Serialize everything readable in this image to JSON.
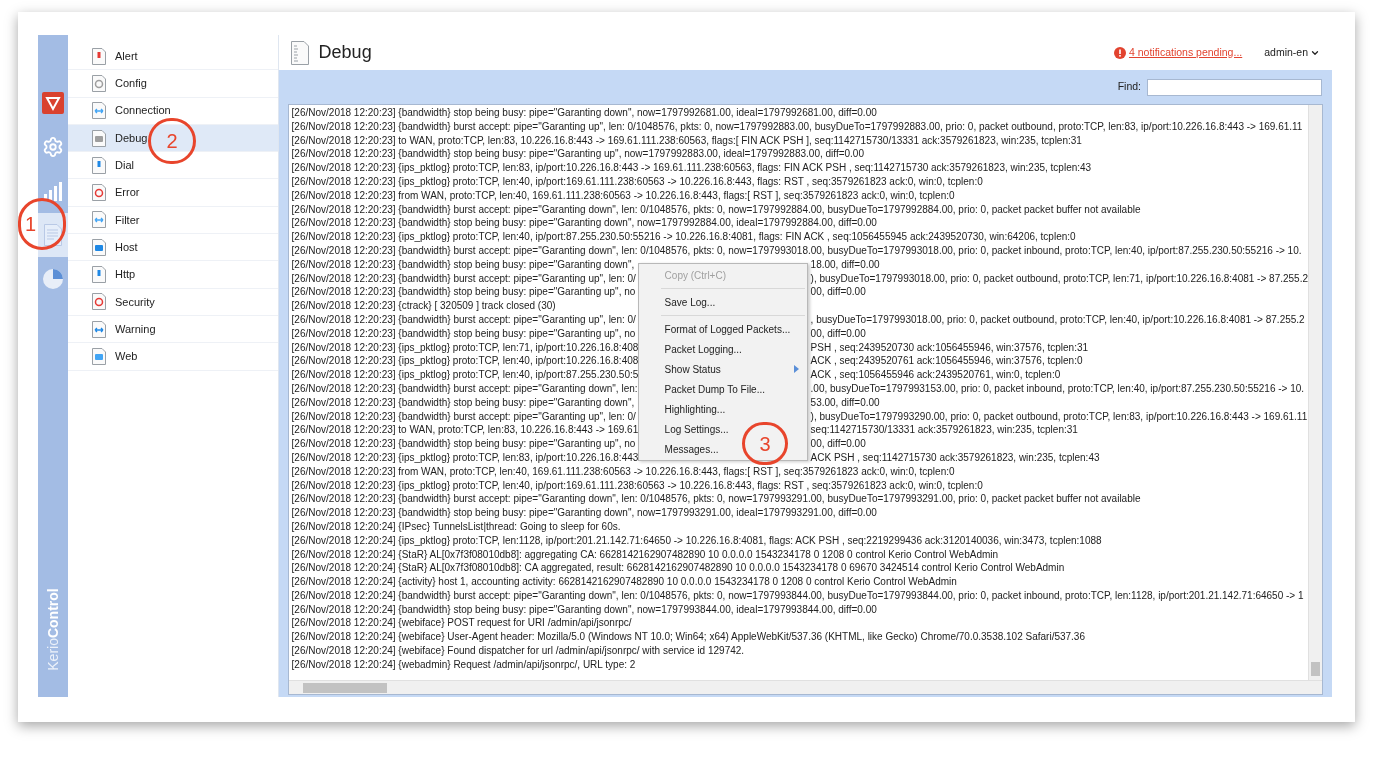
{
  "rail": {
    "brand_light": "Kerio",
    "brand_bold": "Control",
    "items": [
      {
        "selected": false
      },
      {
        "selected": false
      },
      {
        "selected": false
      },
      {
        "selected": true
      },
      {
        "selected": false
      }
    ]
  },
  "log_types": [
    {
      "label": "Alert",
      "selected": false
    },
    {
      "label": "Config",
      "selected": false
    },
    {
      "label": "Connection",
      "selected": false
    },
    {
      "label": "Debug",
      "selected": true
    },
    {
      "label": "Dial",
      "selected": false
    },
    {
      "label": "Error",
      "selected": false
    },
    {
      "label": "Filter",
      "selected": false
    },
    {
      "label": "Host",
      "selected": false
    },
    {
      "label": "Http",
      "selected": false
    },
    {
      "label": "Security",
      "selected": false
    },
    {
      "label": "Warning",
      "selected": false
    },
    {
      "label": "Web",
      "selected": false
    }
  ],
  "header": {
    "title": "Debug",
    "notifications": "4 notifications pending...",
    "user": "admin-en"
  },
  "toolbar": {
    "find_label": "Find:"
  },
  "log_lines": [
    {
      "text": "[26/Nov/2018 12:20:23] {bandwidth} stop being busy: pipe=\"Garanting down\", now=1797992681.00, ideal=1797992681.00, diff=0.00"
    },
    {
      "text": "[26/Nov/2018 12:20:23] {bandwidth} burst accept: pipe=\"Garanting up\", len: 0/1048576, pkts: 0, now=1797992883.00, busyDueTo=1797992883.00, prio: 0, packet outbound, proto:TCP, len:83, ip/port:10.226.16.8:443 -> 169.61.11"
    },
    {
      "text": "[26/Nov/2018 12:20:23] to WAN, proto:TCP, len:83, 10.226.16.8:443 -> 169.61.111.238:60563, flags:[ FIN ACK PSH ], seq:1142715730/13331 ack:3579261823, win:235, tcplen:31"
    },
    {
      "text": "[26/Nov/2018 12:20:23] {bandwidth} stop being busy: pipe=\"Garanting up\", now=1797992883.00, ideal=1797992883.00, diff=0.00"
    },
    {
      "text": "[26/Nov/2018 12:20:23] {ips_pktlog} proto:TCP, len:83, ip/port:10.226.16.8:443 -> 169.61.111.238:60563, flags: FIN ACK PSH , seq:1142715730 ack:3579261823, win:235, tcplen:43"
    },
    {
      "text": "[26/Nov/2018 12:20:23] {ips_pktlog} proto:TCP, len:40, ip/port:169.61.111.238:60563 -> 10.226.16.8:443, flags: RST , seq:3579261823 ack:0, win:0, tcplen:0"
    },
    {
      "text": "[26/Nov/2018 12:20:23] from WAN, proto:TCP, len:40, 169.61.111.238:60563 -> 10.226.16.8:443, flags:[ RST ], seq:3579261823 ack:0, win:0, tcplen:0"
    },
    {
      "text": "[26/Nov/2018 12:20:23] {bandwidth} burst accept: pipe=\"Garanting down\", len: 0/1048576, pkts: 0, now=1797992884.00, busyDueTo=1797992884.00, prio: 0, packet packet buffer not available"
    },
    {
      "text": "[26/Nov/2018 12:20:23] {bandwidth} stop being busy: pipe=\"Garanting down\", now=1797992884.00, ideal=1797992884.00, diff=0.00"
    },
    {
      "text": "[26/Nov/2018 12:20:23] {ips_pktlog} proto:TCP, len:40, ip/port:87.255.230.50:55216 -> 10.226.16.8:4081, flags: FIN ACK , seq:1056455945 ack:2439520730, win:64206, tcplen:0"
    },
    {
      "text": "[26/Nov/2018 12:20:23] {bandwidth} burst accept: pipe=\"Garanting down\", len: 0/1048576, pkts: 0, now=1797993018.00, busyDueTo=1797993018.00, prio: 0, packet inbound, proto:TCP, len:40, ip/port:87.255.230.50:55216 -> 10."
    },
    {
      "left": "[26/Nov/2018 12:20:23] {bandwidth} stop being busy: pipe=\"Garanting down\",",
      "right": "18.00, diff=0.00"
    },
    {
      "left": "[26/Nov/2018 12:20:23] {bandwidth} burst accept: pipe=\"Garanting up\", len: 0/",
      "right": "), busyDueTo=1797993018.00, prio: 0, packet outbound, proto:TCP, len:71, ip/port:10.226.16.8:4081 -> 87.255.2"
    },
    {
      "left": "[26/Nov/2018 12:20:23] {bandwidth} stop being busy: pipe=\"Garanting up\", no",
      "right": "00, diff=0.00"
    },
    {
      "text": "[26/Nov/2018 12:20:23] {ctrack} [ 320509 ] track closed (30)"
    },
    {
      "left": "[26/Nov/2018 12:20:23] {bandwidth} burst accept: pipe=\"Garanting up\", len: 0/",
      "right": ", busyDueTo=1797993018.00, prio: 0, packet outbound, proto:TCP, len:40, ip/port:10.226.16.8:4081 -> 87.255.2"
    },
    {
      "left": "[26/Nov/2018 12:20:23] {bandwidth} stop being busy: pipe=\"Garanting up\", no",
      "right": "00, diff=0.00"
    },
    {
      "left": "[26/Nov/2018 12:20:23] {ips_pktlog} proto:TCP, len:71, ip/port:10.226.16.8:408",
      "right": "PSH , seq:2439520730 ack:1056455946, win:37576, tcplen:31"
    },
    {
      "left": "[26/Nov/2018 12:20:23] {ips_pktlog} proto:TCP, len:40, ip/port:10.226.16.8:408",
      "right": "ACK , seq:2439520761 ack:1056455946, win:37576, tcplen:0"
    },
    {
      "left": "[26/Nov/2018 12:20:23] {ips_pktlog} proto:TCP, len:40, ip/port:87.255.230.50:5",
      "right": "ACK , seq:1056455946 ack:2439520761, win:0, tcplen:0"
    },
    {
      "left": "[26/Nov/2018 12:20:23] {bandwidth} burst accept: pipe=\"Garanting down\", len:",
      "right": ".00, busyDueTo=1797993153.00, prio: 0, packet inbound, proto:TCP, len:40, ip/port:87.255.230.50:55216 -> 10."
    },
    {
      "left": "[26/Nov/2018 12:20:23] {bandwidth} stop being busy: pipe=\"Garanting down\",",
      "right": "53.00, diff=0.00"
    },
    {
      "left": "[26/Nov/2018 12:20:23] {bandwidth} burst accept: pipe=\"Garanting up\", len: 0/",
      "right": "), busyDueTo=1797993290.00, prio: 0, packet outbound, proto:TCP, len:83, ip/port:10.226.16.8:443 -> 169.61.11"
    },
    {
      "left": "[26/Nov/2018 12:20:23] to WAN, proto:TCP, len:83, 10.226.16.8:443 -> 169.61",
      "right": "seq:1142715730/13331 ack:3579261823, win:235, tcplen:31"
    },
    {
      "left": "[26/Nov/2018 12:20:23] {bandwidth} stop being busy: pipe=\"Garanting up\", no",
      "right": "00, diff=0.00"
    },
    {
      "left": "[26/Nov/2018 12:20:23] {ips_pktlog} proto:TCP, len:83, ip/port:10.226.16.8:443",
      "right": "ACK PSH , seq:1142715730 ack:3579261823, win:235, tcplen:43"
    },
    {
      "text": "[26/Nov/2018 12:20:23] from WAN, proto:TCP, len:40, 169.61.111.238:60563 -> 10.226.16.8:443, flags:[ RST ], seq:3579261823 ack:0, win:0, tcplen:0"
    },
    {
      "text": "[26/Nov/2018 12:20:23] {ips_pktlog} proto:TCP, len:40, ip/port:169.61.111.238:60563 -> 10.226.16.8:443, flags: RST , seq:3579261823 ack:0, win:0, tcplen:0"
    },
    {
      "text": "[26/Nov/2018 12:20:23] {bandwidth} burst accept: pipe=\"Garanting down\", len: 0/1048576, pkts: 0, now=1797993291.00, busyDueTo=1797993291.00, prio: 0, packet packet buffer not available"
    },
    {
      "text": "[26/Nov/2018 12:20:23] {bandwidth} stop being busy: pipe=\"Garanting down\", now=1797993291.00, ideal=1797993291.00, diff=0.00"
    },
    {
      "text": "[26/Nov/2018 12:20:24] {IPsec} TunnelsList|thread: Going to sleep for 60s."
    },
    {
      "text": "[26/Nov/2018 12:20:24] {ips_pktlog} proto:TCP, len:1128, ip/port:201.21.142.71:64650 -> 10.226.16.8:4081, flags: ACK PSH , seq:2219299436 ack:3120140036, win:3473, tcplen:1088"
    },
    {
      "text": "[26/Nov/2018 12:20:24] {StaR} AL[0x7f3f08010db8]: aggregating CA: 6628142162907482890 10 0.0.0.0 1543234178 0 1208 0 control Kerio Control WebAdmin"
    },
    {
      "text": "[26/Nov/2018 12:20:24] {StaR} AL[0x7f3f08010db8]: CA aggregated, result: 6628142162907482890 10 0.0.0.0 1543234178 0 69670 3424514 control Kerio Control WebAdmin"
    },
    {
      "text": "[26/Nov/2018 12:20:24] {activity} host 1, accounting activity: 6628142162907482890 10 0.0.0.0 1543234178 0 1208 0 control Kerio Control WebAdmin"
    },
    {
      "text": "[26/Nov/2018 12:20:24] {bandwidth} burst accept: pipe=\"Garanting down\", len: 0/1048576, pkts: 0, now=1797993844.00, busyDueTo=1797993844.00, prio: 0, packet inbound, proto:TCP, len:1128, ip/port:201.21.142.71:64650 -> 1"
    },
    {
      "text": "[26/Nov/2018 12:20:24] {bandwidth} stop being busy: pipe=\"Garanting down\", now=1797993844.00, ideal=1797993844.00, diff=0.00"
    },
    {
      "text": "[26/Nov/2018 12:20:24] {webiface} POST request for URI /admin/api/jsonrpc/"
    },
    {
      "text": "[26/Nov/2018 12:20:24] {webiface} User-Agent header: Mozilla/5.0 (Windows NT 10.0; Win64; x64) AppleWebKit/537.36 (KHTML, like Gecko) Chrome/70.0.3538.102 Safari/537.36"
    },
    {
      "text": "[26/Nov/2018 12:20:24] {webiface} Found dispatcher for url /admin/api/jsonrpc/ with service id 129742."
    },
    {
      "text": "[26/Nov/2018 12:20:24] {webadmin} Request /admin/api/jsonrpc/, URL type: 2"
    }
  ],
  "context_menu": {
    "items": [
      {
        "kind": "item",
        "label": "Copy (Ctrl+C)",
        "disabled": true
      },
      {
        "kind": "separator"
      },
      {
        "kind": "item",
        "label": "Save Log...",
        "disabled": false
      },
      {
        "kind": "separator"
      },
      {
        "kind": "item",
        "label": "Format of Logged Packets...",
        "disabled": false
      },
      {
        "kind": "item",
        "label": "Packet Logging...",
        "disabled": false
      },
      {
        "kind": "submenu",
        "label": "Show Status",
        "disabled": false
      },
      {
        "kind": "item",
        "label": "Packet Dump To File...",
        "disabled": false
      },
      {
        "kind": "item",
        "label": "Highlighting...",
        "disabled": false
      },
      {
        "kind": "item",
        "label": "Log Settings...",
        "disabled": false
      },
      {
        "kind": "item",
        "label": "Messages...",
        "disabled": false
      }
    ]
  },
  "annotations": [
    {
      "label": "1"
    },
    {
      "label": "2"
    },
    {
      "label": "3"
    }
  ]
}
